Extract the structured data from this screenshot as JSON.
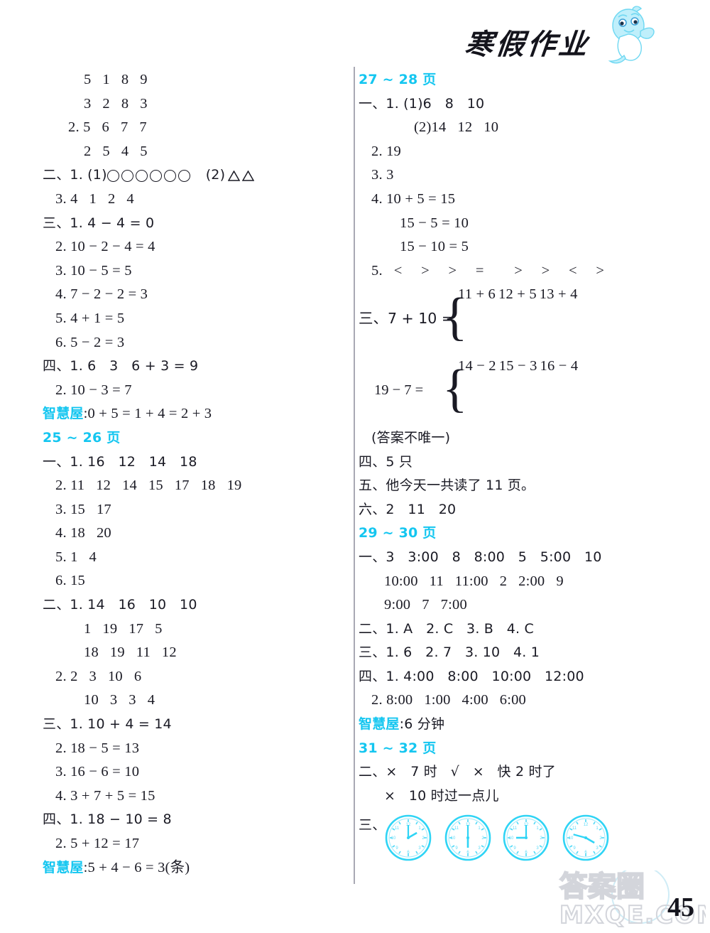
{
  "header": {
    "title": "寒假作业",
    "mascot": "dolphin-mascot"
  },
  "page_number": "45",
  "watermark": {
    "cn": "答案圈",
    "domain": "MXQE.COM"
  },
  "colors": {
    "cyan": "#14c6f0",
    "magenta": "#d13fa8",
    "ink": "#1a1a24",
    "divider": "#a9a9b4"
  },
  "left_column": {
    "lines": [
      {
        "indent": 3,
        "text": "5   1   8   9"
      },
      {
        "indent": 3,
        "text": "3   2   8   3"
      },
      {
        "indent": 2,
        "text": "2. 5   6   7   7"
      },
      {
        "indent": 3,
        "text": "2   5   4   5"
      },
      {
        "indent": 0,
        "text": "二、1. (1)",
        "shapes": "circles6_triangles2",
        "tail": "(2)"
      },
      {
        "indent": 1,
        "text": "3. 4   1   2   4"
      },
      {
        "indent": 0,
        "text": "三、1. 4 − 4 = 0"
      },
      {
        "indent": 1,
        "text": "2. 10 − 2 − 4 = 4"
      },
      {
        "indent": 1,
        "text": "3. 10 − 5 = 5"
      },
      {
        "indent": 1,
        "text": "4. 7 − 2 − 2 = 3"
      },
      {
        "indent": 1,
        "text": "5. 4 + 1 = 5"
      },
      {
        "indent": 1,
        "text": "6. 5 − 2 = 3"
      },
      {
        "indent": 0,
        "text": "四、1. 6   3   6 + 3 = 9"
      },
      {
        "indent": 1,
        "text": "2. 10 − 3 = 7"
      },
      {
        "indent": 0,
        "label": "智慧屋",
        "text": ":0 + 5 = 1 + 4 = 2 + 3"
      },
      {
        "indent": 0,
        "heading": "25 ~ 26 页"
      },
      {
        "indent": 0,
        "text": "一、1. 16   12   14   18"
      },
      {
        "indent": 1,
        "text": "2. 11   12   14   15   17   18   19"
      },
      {
        "indent": 1,
        "text": "3. 15   17"
      },
      {
        "indent": 1,
        "text": "4. 18   20"
      },
      {
        "indent": 1,
        "text": "5. 1   4"
      },
      {
        "indent": 1,
        "text": "6. 15"
      },
      {
        "indent": 0,
        "text": "二、1. 14   16   10   10"
      },
      {
        "indent": 3,
        "text": "1   19   17   5"
      },
      {
        "indent": 3,
        "text": "18   19   11   12"
      },
      {
        "indent": 1,
        "text": "2. 2   3   10   6"
      },
      {
        "indent": 3,
        "text": "10   3   3   4"
      },
      {
        "indent": 0,
        "text": "三、1. 10 + 4 = 14"
      },
      {
        "indent": 1,
        "text": "2. 18 − 5 = 13"
      },
      {
        "indent": 1,
        "text": "3. 16 − 6 = 10"
      },
      {
        "indent": 1,
        "text": "4. 3 + 7 + 5 = 15"
      },
      {
        "indent": 0,
        "text": "四、1. 18 − 10 = 8"
      },
      {
        "indent": 1,
        "text": "2. 5 + 12 = 17"
      },
      {
        "indent": 0,
        "label": "智慧屋",
        "text": ":5 + 4 − 6 = 3(条)"
      }
    ]
  },
  "right_column": {
    "heading_27": "27 ~ 28 页",
    "lines_27": [
      {
        "indent": 0,
        "text": "一、1. (1)6   8   10"
      },
      {
        "indent": 3,
        "text": "(2)14   12   10"
      },
      {
        "indent": 1,
        "text": "2. 19"
      },
      {
        "indent": 1,
        "text": "3. 3"
      },
      {
        "indent": 1,
        "text": "4. 10 + 5 = 15"
      },
      {
        "indent": 3,
        "text": "15 − 5 = 10"
      },
      {
        "indent": 3,
        "text": "15 − 10 = 5"
      },
      {
        "indent": 1,
        "text": "5.   <     >     >     =        >     >     <     >"
      }
    ],
    "brace1": {
      "lead": "三、7 + 10 =",
      "items": [
        "11 + 6",
        "12 + 5",
        "13 + 4"
      ]
    },
    "brace2": {
      "lead": "19 − 7 =",
      "items": [
        "14 − 2",
        "15 − 3",
        "16 − 4"
      ]
    },
    "note": "(答案不唯一)",
    "lines_after": [
      {
        "indent": 0,
        "text": "四、5 只"
      },
      {
        "indent": 0,
        "text": "五、他今天一共读了 11 页。"
      },
      {
        "indent": 0,
        "text": "六、2   11   20"
      }
    ],
    "heading_29": "29 ~ 30 页",
    "lines_29": [
      {
        "indent": 0,
        "text": "一、3   3:00   8   8:00   5   5:00   10"
      },
      {
        "indent": 2,
        "text": "10:00   11   11:00   2   2:00   9"
      },
      {
        "indent": 2,
        "text": "9:00   7   7:00"
      },
      {
        "indent": 0,
        "text": "二、1. A   2. C   3. B   4. C"
      },
      {
        "indent": 0,
        "text": "三、1. 6   2. 7   3. 10   4. 1"
      },
      {
        "indent": 0,
        "text": "四、1. 4:00   8:00   10:00   12:00"
      },
      {
        "indent": 1,
        "text": "2. 8:00   1:00   4:00   6:00"
      },
      {
        "indent": 0,
        "label": "智慧屋",
        "text": ":6 分钟"
      }
    ],
    "heading_31": "31 ~ 32 页",
    "lines_31": [
      {
        "indent": 0,
        "text": "二、×   7 时   √   ×   快 2 时了"
      },
      {
        "indent": 2,
        "text": "×   10 时过一点儿"
      }
    ],
    "clocks_label": "三、",
    "clocks": [
      {
        "name": "clock-1",
        "hour_deg": 60,
        "minute_deg": 0
      },
      {
        "name": "clock-2",
        "hour_deg": 180,
        "minute_deg": 0
      },
      {
        "name": "clock-3",
        "hour_deg": 270,
        "minute_deg": 0
      },
      {
        "name": "clock-4",
        "hour_deg": 120,
        "minute_deg": 285
      }
    ]
  }
}
